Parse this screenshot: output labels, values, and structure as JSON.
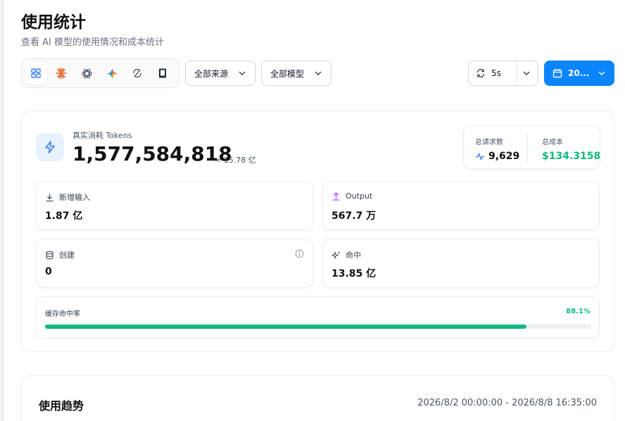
{
  "header": {
    "title": "使用统计",
    "subtitle": "查看 AI 模型的使用情况和成本统计"
  },
  "toolbar": {
    "providers": [
      {
        "icon": "grid-icon",
        "active": true
      },
      {
        "icon": "claude-icon"
      },
      {
        "icon": "openai-icon"
      },
      {
        "icon": "gemini-icon"
      },
      {
        "icon": "refresh-circle-icon"
      },
      {
        "icon": "device-icon"
      }
    ],
    "source_select": "全部来源",
    "model_select": "全部模型",
    "refresh_interval": "5s",
    "date_button": "20..."
  },
  "tokens": {
    "label": "真实消耗 Tokens",
    "value": "1,577,584,818",
    "approx": "≈ 15.78 亿"
  },
  "summary": {
    "requests_label": "总请求数",
    "requests_value": "9,629",
    "cost_label": "总成本",
    "cost_value": "$134.3158"
  },
  "stats": {
    "input": {
      "label": "新增输入",
      "value": "1.87 亿"
    },
    "output": {
      "label": "Output",
      "value": "567.7 万"
    },
    "create": {
      "label": "创建",
      "value": "0"
    },
    "hit": {
      "label": "命中",
      "value": "13.85 亿"
    }
  },
  "cache": {
    "label": "缓存命中率",
    "percent_text": "88.1%",
    "percent": 88.1
  },
  "trend": {
    "title": "使用趋势",
    "range": "2026/8/2 00:00:00 - 2026/8/8 16:35:00"
  },
  "colors": {
    "accent": "#0b84ff",
    "green": "#10b981"
  }
}
